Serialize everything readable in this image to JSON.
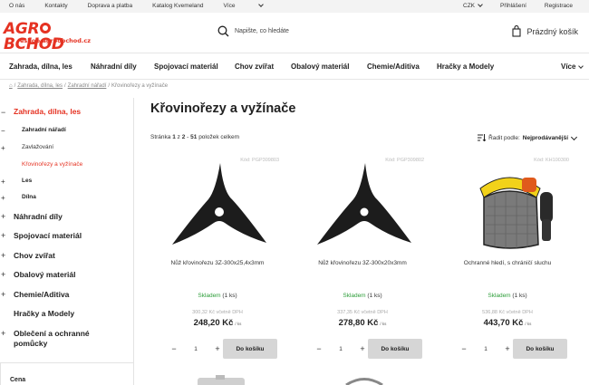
{
  "topbar": {
    "links": [
      "O nás",
      "Kontakty",
      "Doprava a platba",
      "Katalog Kvemeland",
      "Více"
    ],
    "currency": "CZK",
    "login": "Přihlášení",
    "register": "Registrace"
  },
  "header": {
    "logo_text": "AGR   BCHOD",
    "logo_sub": "eshop.agroobchod.cz",
    "search_placeholder": "Napište, co hledáte",
    "cart_label": "Prázdný košík"
  },
  "nav": {
    "items": [
      "Zahrada, dílna, les",
      "Náhradní díly",
      "Spojovací materiál",
      "Chov zvířat",
      "Obalový materiál",
      "Chemie/Aditiva",
      "Hračky a Modely"
    ],
    "more": "Více"
  },
  "breadcrumb": {
    "home": "⌂",
    "items": [
      "Zahrada, dílna, les",
      "Zahradní nářadí"
    ],
    "current": "Křovinořezy a vyžínače"
  },
  "sidebar": {
    "categories": [
      {
        "label": "Zahrada, dílna, les",
        "active": true,
        "sign": "−"
      },
      {
        "label": "Náhradní díly",
        "sign": "+"
      },
      {
        "label": "Spojovací materiál",
        "sign": "+"
      },
      {
        "label": "Chov zvířat",
        "sign": "+"
      },
      {
        "label": "Obalový materiál",
        "sign": "+"
      },
      {
        "label": "Chemie/Aditiva",
        "sign": "+"
      },
      {
        "label": "Hračky a Modely",
        "sign": ""
      },
      {
        "label": "Oblečení a ochranné pomůcky",
        "sign": "+"
      }
    ],
    "subs": [
      {
        "label": "Zahradní nářadí",
        "bold": true,
        "sign": "−"
      },
      {
        "label": "Zavlažování",
        "sign": "+"
      },
      {
        "label": "Křovinořezy a vyžínače",
        "active": true,
        "sign": ""
      },
      {
        "label": "Les",
        "bold": true,
        "sign": "+"
      },
      {
        "label": "Dílna",
        "bold": true,
        "sign": "+"
      }
    ],
    "filter_title": "Cena"
  },
  "content": {
    "title": "Křovinořezy a vyžínače",
    "page_label": "Stránka",
    "page_current": "1",
    "page_of": "z",
    "page_total": "2",
    "item_count": "51",
    "items_suffix": "položek celkem",
    "sort_label": "Řadit podle:",
    "sort_value": "Nejprodávanější"
  },
  "products": [
    {
      "code": "Kód: PGP309803",
      "name": "Nůž křovinořezu 3Z-300x25,4x3mm",
      "stock_label": "Skladem",
      "stock_qty": "(1 ks)",
      "old_price": "300,32 Kč včetně DPH",
      "price": "248,20 Kč",
      "unit": "/ ks",
      "qty": "1",
      "add": "Do košíku",
      "icon": "brush-cutter-blade-icon"
    },
    {
      "code": "Kód: PGP309802",
      "name": "Nůž křovinořezu 3Z-300x20x3mm",
      "stock_label": "Skladem",
      "stock_qty": "(1 ks)",
      "old_price": "337,35 Kč včetně DPH",
      "price": "278,80 Kč",
      "unit": "/ ks",
      "qty": "1",
      "add": "Do košíku",
      "icon": "brush-cutter-blade-icon"
    },
    {
      "code": "Kód: KH100300",
      "name": "Ochranné hledí, s chráničí sluchu",
      "stock_label": "Skladem",
      "stock_qty": "(1 ks)",
      "old_price": "536,88 Kč včetně DPH",
      "price": "443,70 Kč",
      "unit": "/ ks",
      "qty": "1",
      "add": "Do košíku",
      "icon": "face-shield-icon"
    }
  ],
  "colors": {
    "brand": "#e53222",
    "stock": "#2e9e3a",
    "cart_button": "#d6d6d6"
  }
}
